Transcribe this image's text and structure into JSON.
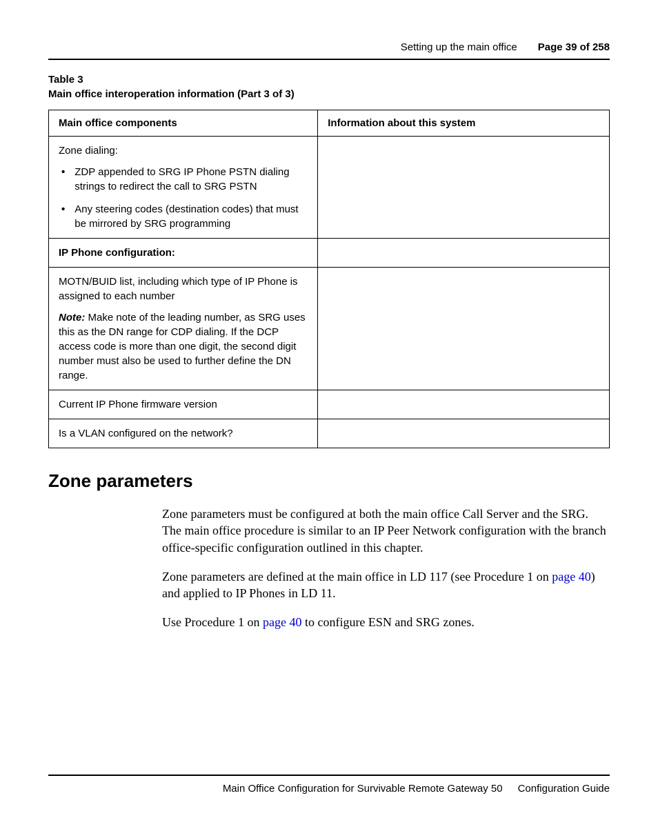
{
  "header": {
    "section": "Setting up the main office",
    "page_label": "Page 39 of 258"
  },
  "table": {
    "caption_line1": "Table 3",
    "caption_line2": "Main office interoperation information (Part 3 of 3)",
    "col1_header": "Main office components",
    "col2_header": "Information about this system",
    "zone_dialing_intro": "Zone dialing:",
    "zone_bullet1": "ZDP appended to SRG IP Phone PSTN dialing strings to redirect the call to SRG PSTN",
    "zone_bullet2": "Any steering codes (destination codes) that must be mirrored by SRG programming",
    "ip_phone_config": "IP Phone configuration:",
    "motn_buid": "MOTN/BUID list, including which type of IP Phone is assigned to each number",
    "note_label": "Note:",
    "note_text": "  Make note of the leading number, as SRG uses this as the DN range for CDP dialing. If the DCP access code is more than one digit, the second digit number must also be used to further define the DN range.",
    "firmware": "Current IP Phone firmware version",
    "vlan": "Is a VLAN configured on the network?"
  },
  "section": {
    "heading": "Zone parameters",
    "para1": "Zone parameters must be configured at both the main office Call Server and the SRG. The main office procedure is similar to an IP Peer Network configuration with the branch office-specific configuration outlined in this chapter.",
    "para2_pre": "Zone parameters are defined at the main office in LD 117 (see Procedure 1 on ",
    "para2_link": "page 40",
    "para2_post": ") and applied to IP Phones in LD 11.",
    "para3_pre": "Use Procedure 1 on ",
    "para3_link": "page 40",
    "para3_post": " to configure ESN and SRG zones."
  },
  "footer": {
    "left": "Main Office Configuration for Survivable Remote Gateway 50",
    "right": "Configuration Guide"
  }
}
